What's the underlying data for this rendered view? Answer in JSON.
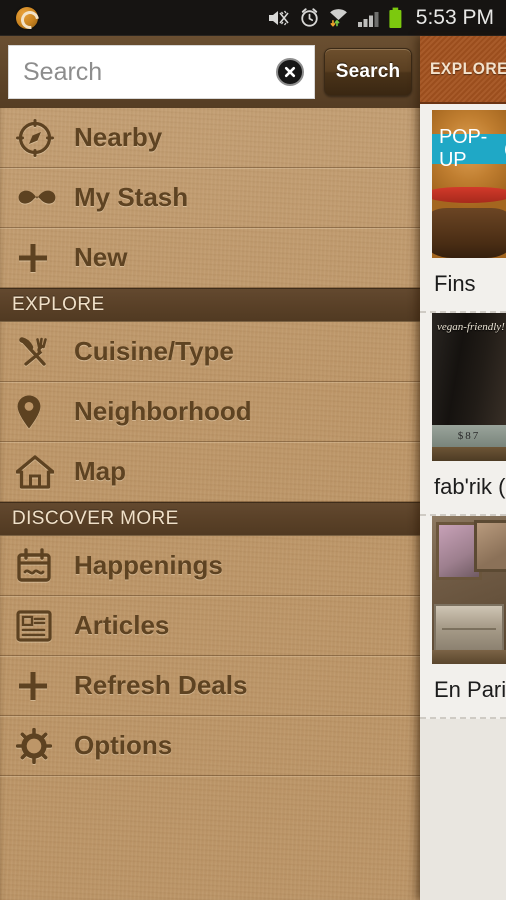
{
  "statusbar": {
    "time": "5:53 PM",
    "app_icon": "app-logo-icon",
    "icons": [
      "mute-vibrate-icon",
      "alarm-clock-icon",
      "wifi-data-icon",
      "signal-bars-icon",
      "battery-icon"
    ]
  },
  "search": {
    "placeholder": "Search",
    "value": "",
    "clear_label": "clear-icon",
    "button_label": "Search"
  },
  "menu": {
    "top_items": [
      {
        "label": "Nearby",
        "icon": "compass-icon"
      },
      {
        "label": "My Stash",
        "icon": "mustache-icon"
      },
      {
        "label": "New",
        "icon": "plus-icon"
      }
    ],
    "explore_header": "EXPLORE",
    "explore_items": [
      {
        "label": "Cuisine/Type",
        "icon": "fork-knife-icon"
      },
      {
        "label": "Neighborhood",
        "icon": "map-pin-icon"
      },
      {
        "label": "Map",
        "icon": "house-icon"
      }
    ],
    "discover_header": "DISCOVER MORE",
    "discover_items": [
      {
        "label": "Happenings",
        "icon": "calendar-icon"
      },
      {
        "label": "Articles",
        "icon": "article-icon"
      },
      {
        "label": "Refresh Deals",
        "icon": "plus-icon"
      },
      {
        "label": "Options",
        "icon": "gear-icon"
      }
    ]
  },
  "content": {
    "header_title": "EXPLORE",
    "cards": [
      {
        "title": "Fins",
        "badge": "POP-UP",
        "badge_icon": "clock-icon",
        "photo": "burger-photo"
      },
      {
        "title": "fab'rik (",
        "photo": "boutique-photo",
        "photo_text": "vegan-friendly!",
        "photo_price": "$87"
      },
      {
        "title": "En Paris",
        "photo": "vintage-shop-photo"
      }
    ]
  },
  "colors": {
    "kraft": "#bd9668",
    "section_band": "#594027",
    "search_bar": "#5d4429",
    "explore_orange": "#a3521f",
    "badge_teal": "#1fa8c6",
    "label_brown": "#5e4322"
  }
}
